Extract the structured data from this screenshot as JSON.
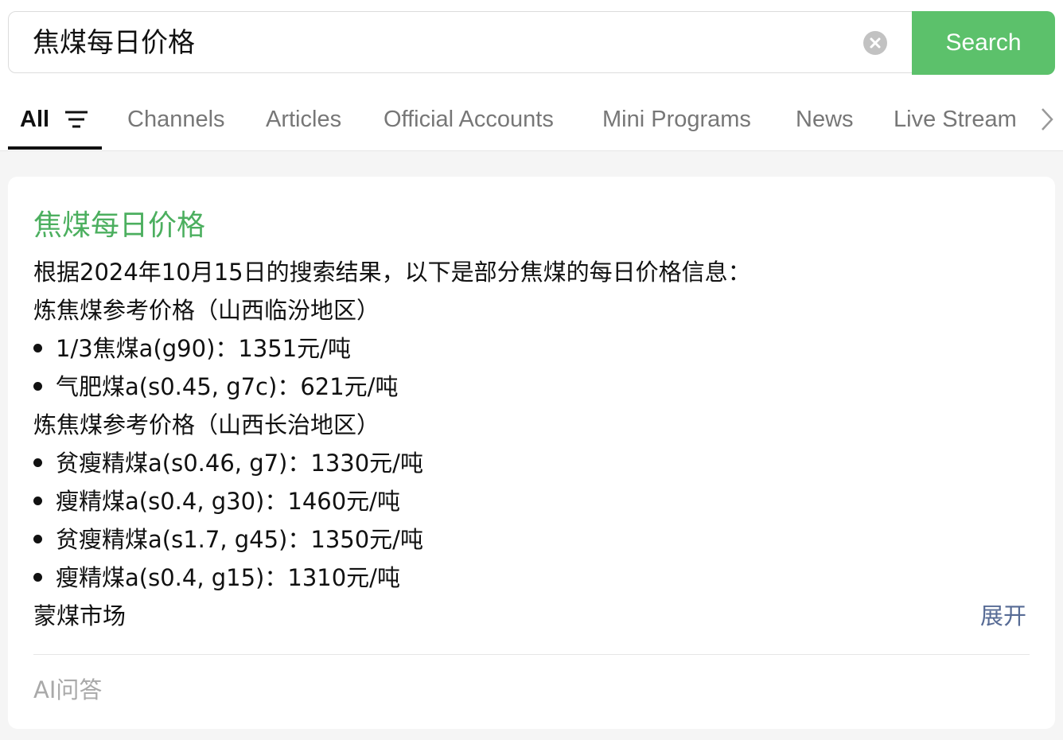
{
  "search": {
    "query": "焦煤每日价格",
    "button_label": "Search",
    "clear_icon": "clear-icon"
  },
  "tabs": {
    "items": [
      {
        "label": "All",
        "active": true
      },
      {
        "label": "Channels"
      },
      {
        "label": "Articles"
      },
      {
        "label": "Official Accounts"
      },
      {
        "label": "Mini Programs"
      },
      {
        "label": "News"
      },
      {
        "label": "Live Stream"
      }
    ],
    "filter_icon": "filter-icon",
    "more_icon": "chevron-right-icon"
  },
  "card": {
    "title": "焦煤每日价格",
    "intro": "根据2024年10月15日的搜索结果，以下是部分焦煤的每日价格信息：",
    "section1": "炼焦煤参考价格（山西临汾地区）",
    "section1_items": [
      "1/3焦煤a(g90)：1351元/吨",
      "气肥煤a(s0.45, g7c)：621元/吨"
    ],
    "section2": "炼焦煤参考价格（山西长治地区）",
    "section2_items": [
      "贫瘦精煤a(s0.46, g7)：1330元/吨",
      "瘦精煤a(s0.4, g30)：1460元/吨",
      "贫瘦精煤a(s1.7, g45)：1350元/吨",
      "瘦精煤a(s0.4, g15)：1310元/吨"
    ],
    "section3": "蒙煤市场",
    "expand_label": "展开",
    "footer_label": "AI问答"
  },
  "colors": {
    "accent": "#5cc16b",
    "title_green": "#4caf5f",
    "link_blue": "#576b95"
  }
}
